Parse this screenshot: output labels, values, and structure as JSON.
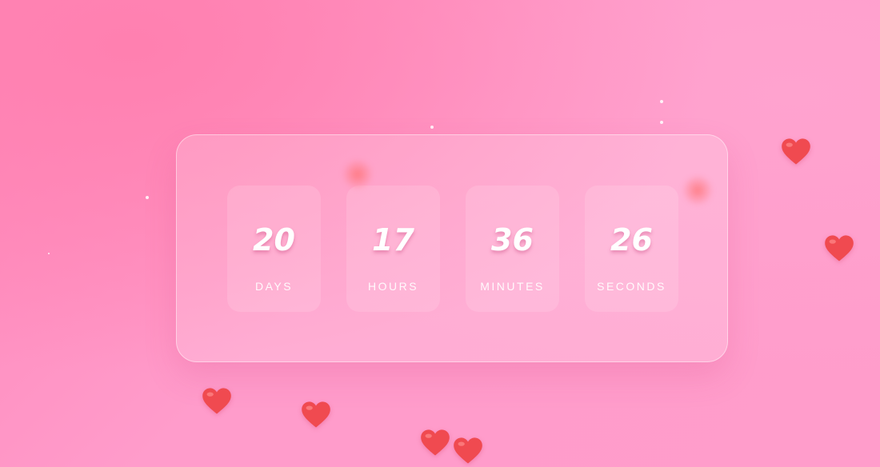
{
  "countdown": {
    "units": [
      {
        "value": "20",
        "label": "DAYS"
      },
      {
        "value": "17",
        "label": "HOURS"
      },
      {
        "value": "36",
        "label": "MINUTES"
      },
      {
        "value": "26",
        "label": "SECONDS"
      }
    ]
  },
  "colors": {
    "background_start": "#ff86b8",
    "background_end": "#ff9dcb",
    "heart": "#f04a50",
    "text": "#ffffff"
  },
  "decorations": {
    "heart_icon": "heart-icon",
    "sparkle_icon": "sparkle-icon"
  }
}
